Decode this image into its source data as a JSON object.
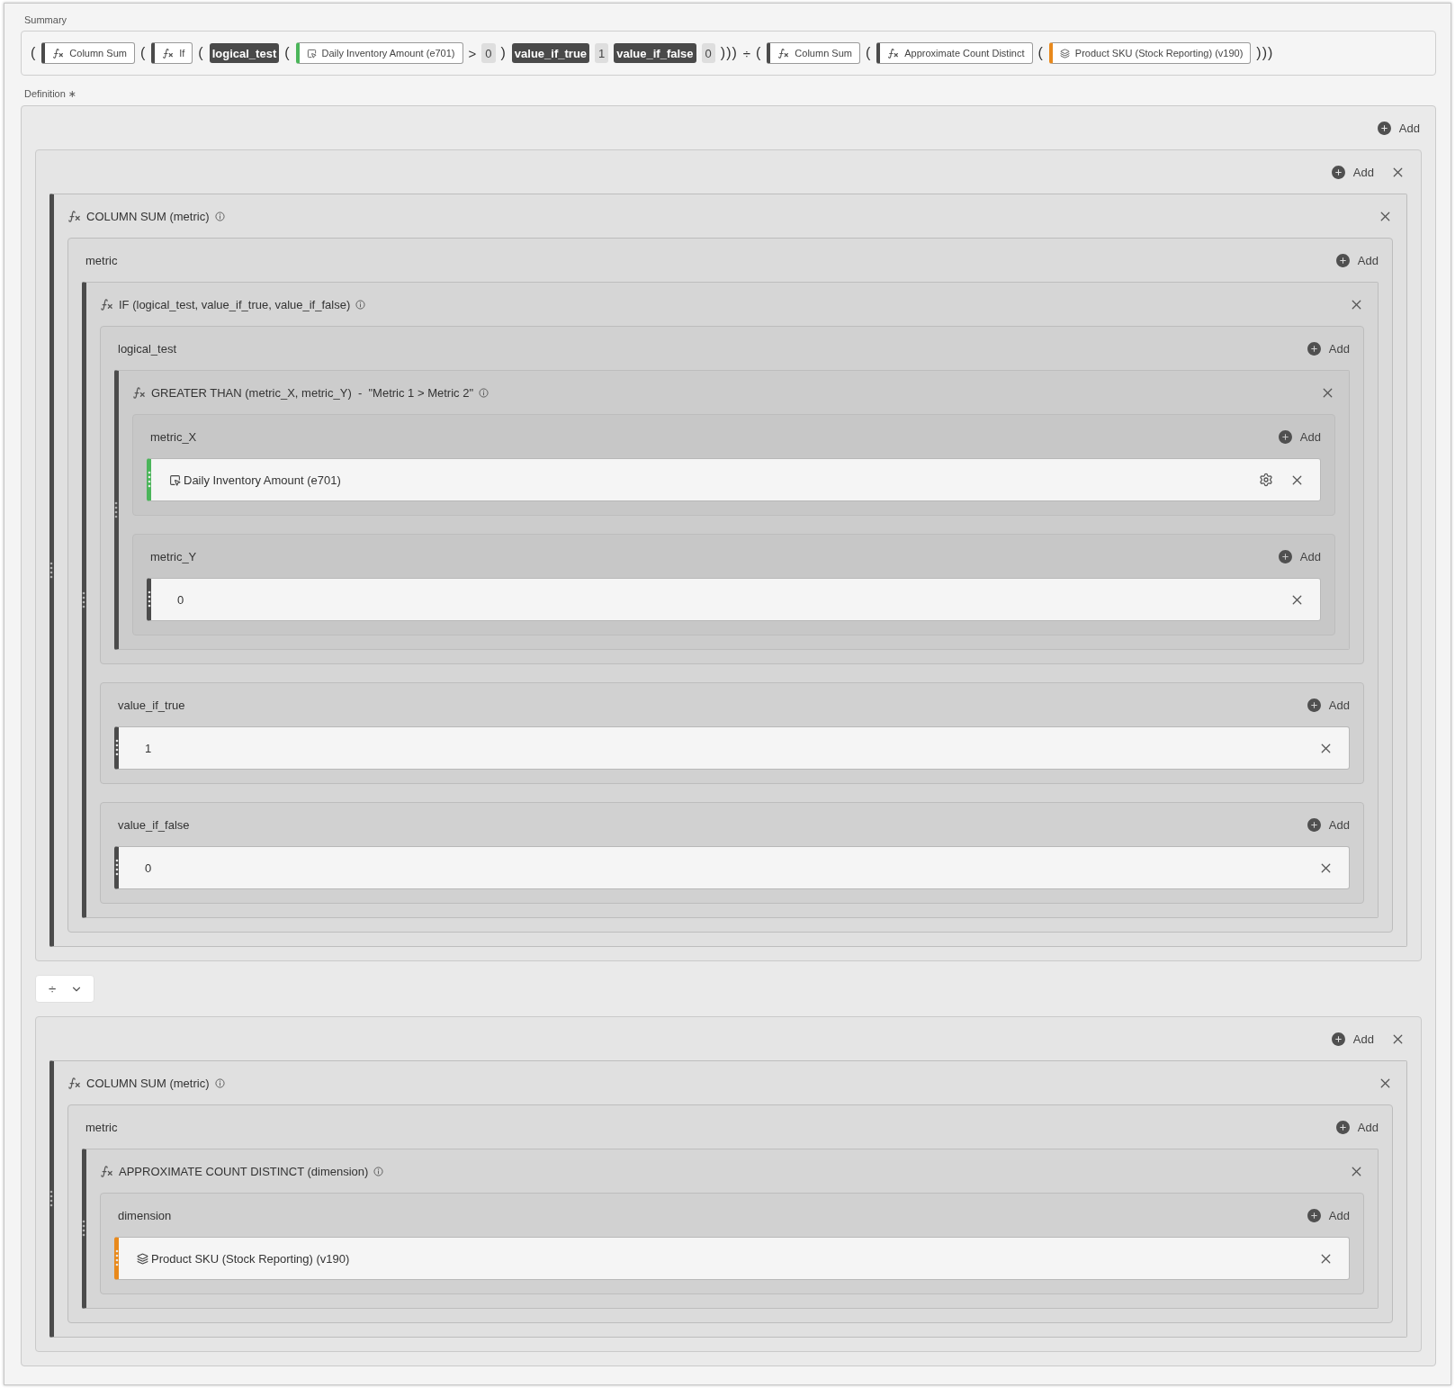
{
  "summary": {
    "label": "Summary",
    "tokens": [
      {
        "kind": "paren",
        "text": "("
      },
      {
        "kind": "function",
        "text": "Column Sum"
      },
      {
        "kind": "paren",
        "text": "("
      },
      {
        "kind": "function",
        "text": "If"
      },
      {
        "kind": "paren",
        "text": "("
      },
      {
        "kind": "argument",
        "text": "logical_test"
      },
      {
        "kind": "paren",
        "text": "("
      },
      {
        "kind": "metric",
        "text": "Daily Inventory Amount (e701)"
      },
      {
        "kind": "operator",
        "text": ">"
      },
      {
        "kind": "number",
        "text": "0"
      },
      {
        "kind": "paren",
        "text": ")"
      },
      {
        "kind": "argument",
        "text": "value_if_true"
      },
      {
        "kind": "number",
        "text": "1"
      },
      {
        "kind": "argument",
        "text": "value_if_false"
      },
      {
        "kind": "number",
        "text": "0"
      },
      {
        "kind": "paren",
        "text": ")))"
      },
      {
        "kind": "operator",
        "text": "÷"
      },
      {
        "kind": "paren",
        "text": "("
      },
      {
        "kind": "function",
        "text": "Column Sum"
      },
      {
        "kind": "paren",
        "text": "("
      },
      {
        "kind": "function",
        "text": "Approximate Count Distinct"
      },
      {
        "kind": "paren",
        "text": "("
      },
      {
        "kind": "dimension",
        "text": "Product SKU (Stock Reporting) (v190)"
      },
      {
        "kind": "paren",
        "text": ")))"
      }
    ]
  },
  "definition": {
    "label": "Definition",
    "required_mark": "∗",
    "add": "Add",
    "blocks": [
      {
        "kind": "group",
        "add": "Add",
        "children": [
          {
            "kind": "function",
            "title": "COLUMN SUM (metric)",
            "children": [
              {
                "kind": "param",
                "label": "metric",
                "add": "Add",
                "children": [
                  {
                    "kind": "function",
                    "title": "IF (logical_test, value_if_true, value_if_false)",
                    "children": [
                      {
                        "kind": "param",
                        "label": "logical_test",
                        "add": "Add",
                        "children": [
                          {
                            "kind": "function",
                            "title": "GREATER THAN (metric_X, metric_Y)  -  \"Metric 1 > Metric 2\"",
                            "children": [
                              {
                                "kind": "param",
                                "label": "metric_X",
                                "add": "Add",
                                "children": [
                                  {
                                    "kind": "metric",
                                    "text": "Daily Inventory Amount (e701)",
                                    "settings": true
                                  }
                                ]
                              },
                              {
                                "kind": "param",
                                "label": "metric_Y",
                                "add": "Add",
                                "children": [
                                  {
                                    "kind": "number",
                                    "text": "0",
                                    "settings": false
                                  }
                                ]
                              }
                            ]
                          }
                        ]
                      },
                      {
                        "kind": "param",
                        "label": "value_if_true",
                        "add": "Add",
                        "children": [
                          {
                            "kind": "number",
                            "text": "1",
                            "settings": false
                          }
                        ]
                      },
                      {
                        "kind": "param",
                        "label": "value_if_false",
                        "add": "Add",
                        "children": [
                          {
                            "kind": "number",
                            "text": "0",
                            "settings": false
                          }
                        ]
                      }
                    ]
                  }
                ]
              }
            ]
          }
        ]
      },
      {
        "kind": "operator",
        "symbol": "÷"
      },
      {
        "kind": "group",
        "add": "Add",
        "children": [
          {
            "kind": "function",
            "title": "COLUMN SUM (metric)",
            "children": [
              {
                "kind": "param",
                "label": "metric",
                "add": "Add",
                "children": [
                  {
                    "kind": "function",
                    "title": "APPROXIMATE COUNT DISTINCT (dimension)",
                    "children": [
                      {
                        "kind": "param",
                        "label": "dimension",
                        "add": "Add",
                        "children": [
                          {
                            "kind": "dimension",
                            "text": "Product SKU (Stock Reporting) (v190)",
                            "settings": false
                          }
                        ]
                      }
                    ]
                  }
                ]
              }
            ]
          }
        ]
      }
    ]
  }
}
